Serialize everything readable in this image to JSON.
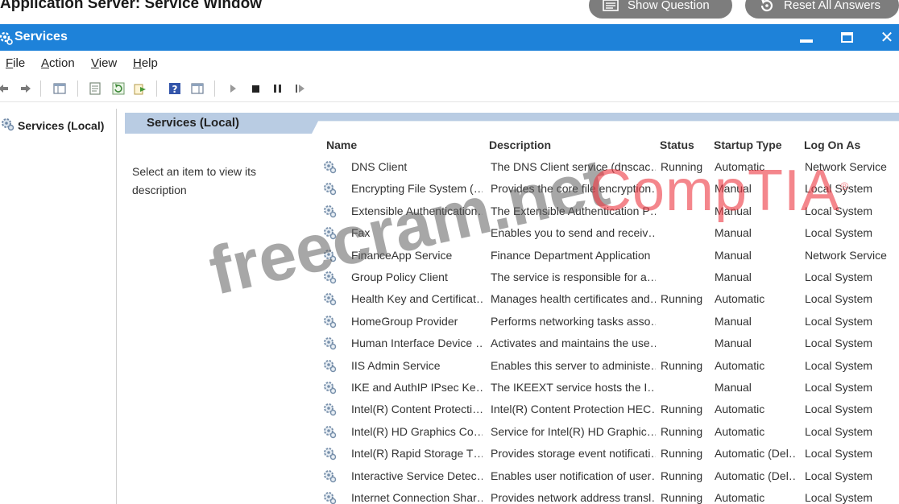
{
  "page": {
    "heading": "Application Server: Service Window",
    "show_question_label": "Show Question",
    "reset_answers_label": "Reset All Answers"
  },
  "window": {
    "title": "Services",
    "close_glyph": "✕"
  },
  "menu": {
    "file": {
      "first": "F",
      "rest": "ile"
    },
    "action": {
      "first": "A",
      "rest": "ction"
    },
    "view": {
      "first": "V",
      "rest": "iew"
    },
    "help": {
      "first": "H",
      "rest": "elp"
    }
  },
  "tree": {
    "root_label": "Services (Local)"
  },
  "pane": {
    "header": "Services (Local)",
    "description_prompt": "Select an item to view its description"
  },
  "columns": {
    "name": "Name",
    "description": "Description",
    "status": "Status",
    "startup_type": "Startup Type",
    "log_on_as": "Log On As"
  },
  "services": [
    {
      "name": "DNS Client",
      "description": "The DNS Client service (dnscac…",
      "status": "Running",
      "startup": "Automatic",
      "logon": "Network Service"
    },
    {
      "name": "Encrypting File System (…",
      "description": "Provides the core file encryption…",
      "status": "",
      "startup": "Manual",
      "logon": "Local System"
    },
    {
      "name": "Extensible Authentication…",
      "description": "The Extensible Authentication P…",
      "status": "",
      "startup": "Manual",
      "logon": "Local System"
    },
    {
      "name": "Fax",
      "description": "Enables you to send and receiv…",
      "status": "",
      "startup": "Manual",
      "logon": "Local System"
    },
    {
      "name": "FinanceApp Service",
      "description": "Finance Department Application",
      "status": "",
      "startup": "Manual",
      "logon": "Network Service"
    },
    {
      "name": "Group Policy Client",
      "description": "The service is responsible for a…",
      "status": "",
      "startup": "Manual",
      "logon": "Local System"
    },
    {
      "name": "Health Key and Certificat…",
      "description": "Manages health certificates and…",
      "status": "Running",
      "startup": "Automatic",
      "logon": "Local System"
    },
    {
      "name": "HomeGroup Provider",
      "description": "Performs networking tasks asso…",
      "status": "",
      "startup": "Manual",
      "logon": "Local System"
    },
    {
      "name": "Human Interface Device …",
      "description": "Activates and maintains the use…",
      "status": "",
      "startup": "Manual",
      "logon": "Local System"
    },
    {
      "name": "IIS Admin Service",
      "description": "Enables this server to administe…",
      "status": "Running",
      "startup": "Automatic",
      "logon": "Local System"
    },
    {
      "name": "IKE and AuthIP IPsec Ke…",
      "description": "The IKEEXT service hosts the I…",
      "status": "",
      "startup": "Manual",
      "logon": "Local System"
    },
    {
      "name": "Intel(R) Content Protecti…",
      "description": "Intel(R) Content Protection HEC…",
      "status": "Running",
      "startup": "Automatic",
      "logon": "Local System"
    },
    {
      "name": "Intel(R) HD Graphics Co…",
      "description": "Service for Intel(R) HD Graphic…",
      "status": "Running",
      "startup": "Automatic",
      "logon": "Local System"
    },
    {
      "name": "Intel(R) Rapid Storage T…",
      "description": "Provides storage event notificati…",
      "status": "Running",
      "startup": "Automatic (Del…",
      "logon": "Local System"
    },
    {
      "name": "Interactive Service Detec…",
      "description": "Enables user notification of user…",
      "status": "Running",
      "startup": "Automatic (Del…",
      "logon": "Local System"
    },
    {
      "name": "Internet Connection Shar…",
      "description": "Provides network address transl…",
      "status": "Running",
      "startup": "Automatic",
      "logon": "Local System"
    }
  ],
  "watermarks": {
    "freecram": "freecram.net",
    "comptia": "CompTIA",
    "comptia_mark": "®"
  },
  "colors": {
    "titlebar": "#1e82d9",
    "pane_header": "#b9cce3",
    "pill_button": "#7d7d7d",
    "comptia_red": "#ee3c46"
  }
}
